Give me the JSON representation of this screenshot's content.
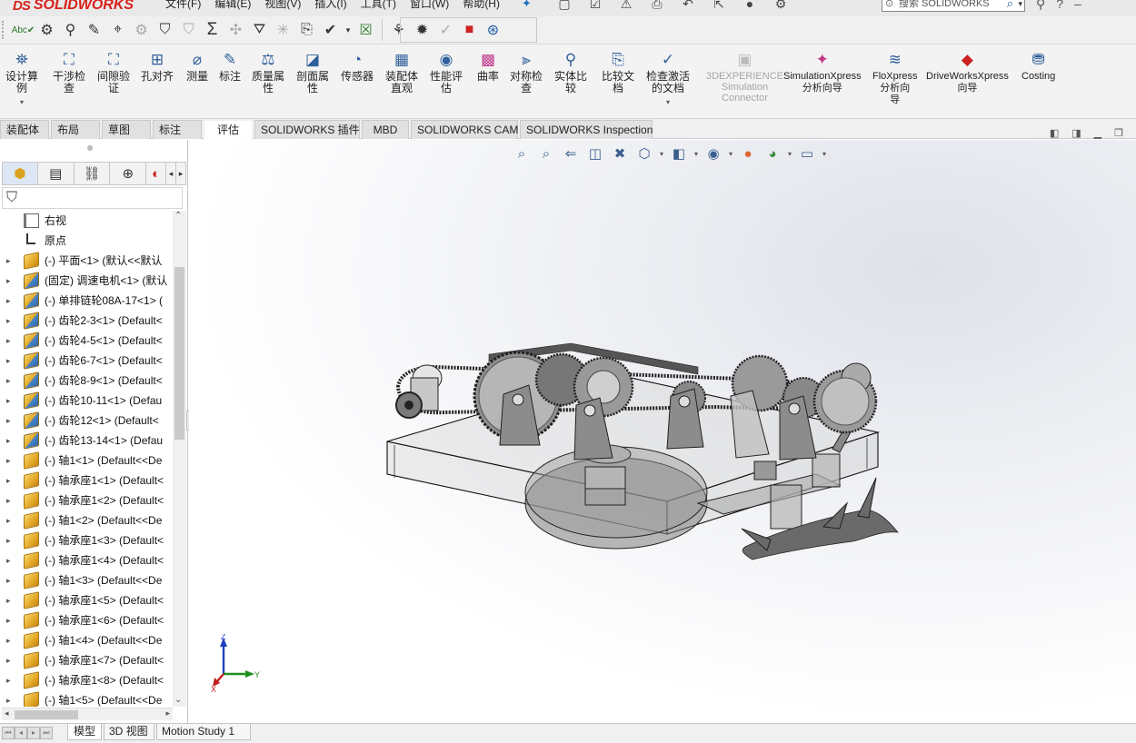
{
  "app": {
    "brand_ds": "DS",
    "brand_word": "SOLIDWORKS"
  },
  "menu": {
    "items": [
      "文件(F)",
      "编辑(E)",
      "视图(V)",
      "插入(I)",
      "工具(T)",
      "窗口(W)",
      "帮助(H)"
    ]
  },
  "search": {
    "placeholder": "搜索 SOLIDWORKS"
  },
  "command_manager": {
    "items": [
      {
        "label": "设计算\n例",
        "icon": "design-study-icon"
      },
      {
        "label": "干涉检\n查",
        "icon": "interference-icon"
      },
      {
        "label": "间隙验\n证",
        "icon": "clearance-icon"
      },
      {
        "label": "孔对齐",
        "icon": "hole-alignment-icon"
      },
      {
        "label": "测量",
        "icon": "measure-icon"
      },
      {
        "label": "标注",
        "icon": "markup-icon"
      },
      {
        "label": "质量属\n性",
        "icon": "mass-properties-icon"
      },
      {
        "label": "剖面属\n性",
        "icon": "section-properties-icon"
      },
      {
        "label": "传感器",
        "icon": "sensor-icon"
      },
      {
        "label": "装配体\n直观",
        "icon": "assembly-visualization-icon"
      },
      {
        "label": "性能评\n估",
        "icon": "performance-icon"
      },
      {
        "label": "曲率",
        "icon": "curvature-icon"
      },
      {
        "label": "对称检\n查",
        "icon": "symmetry-icon"
      },
      {
        "label": "实体比\n较",
        "icon": "body-compare-icon"
      },
      {
        "label": "比较文\n档",
        "icon": "compare-docs-icon"
      },
      {
        "label": "检查激活\n的文档",
        "icon": "check-doc-icon"
      },
      {
        "label": "3DEXPERIENCE\nSimulation\nConnector",
        "icon": "3dx-icon"
      },
      {
        "label": "SimulationXpress\n分析向导",
        "icon": "simxpress-icon"
      },
      {
        "label": "FloXpress\n分析向\n导",
        "icon": "floxpress-icon"
      },
      {
        "label": "DriveWorksXpress\n向导",
        "icon": "driveworks-icon"
      },
      {
        "label": "Costing",
        "icon": "costing-icon"
      }
    ]
  },
  "tabs": [
    "装配体",
    "布局",
    "草图",
    "标注",
    "评估",
    "SOLIDWORKS 插件",
    "MBD",
    "SOLIDWORKS CAM",
    "SOLIDWORKS Inspection"
  ],
  "active_tab": "评估",
  "feature_tree": {
    "items": [
      {
        "label": "右视",
        "kind": "plane",
        "expandable": false
      },
      {
        "label": "原点",
        "kind": "origin",
        "expandable": false
      },
      {
        "label": "(-) 平面<1> (默认<<默认",
        "kind": "part",
        "expandable": true
      },
      {
        "label": "(固定) 调速电机<1> (默认",
        "kind": "asm",
        "expandable": true
      },
      {
        "label": "(-) 单排链轮08A-17<1> (",
        "kind": "asm",
        "expandable": true
      },
      {
        "label": "(-) 齿轮2-3<1> (Default<",
        "kind": "asm",
        "expandable": true
      },
      {
        "label": "(-) 齿轮4-5<1> (Default<",
        "kind": "asm",
        "expandable": true
      },
      {
        "label": "(-) 齿轮6-7<1> (Default<",
        "kind": "asm",
        "expandable": true
      },
      {
        "label": "(-) 齿轮8-9<1> (Default<",
        "kind": "asm",
        "expandable": true
      },
      {
        "label": "(-) 齿轮10-11<1> (Defau",
        "kind": "asm",
        "expandable": true
      },
      {
        "label": "(-) 齿轮12<1> (Default<",
        "kind": "asm",
        "expandable": true
      },
      {
        "label": "(-) 齿轮13-14<1> (Defau",
        "kind": "asm",
        "expandable": true
      },
      {
        "label": "(-) 轴1<1> (Default<<De",
        "kind": "part",
        "expandable": true
      },
      {
        "label": "(-) 轴承座1<1> (Default<",
        "kind": "part",
        "expandable": true
      },
      {
        "label": "(-) 轴承座1<2> (Default<",
        "kind": "part",
        "expandable": true
      },
      {
        "label": "(-) 轴1<2> (Default<<De",
        "kind": "part",
        "expandable": true
      },
      {
        "label": "(-) 轴承座1<3> (Default<",
        "kind": "part",
        "expandable": true
      },
      {
        "label": "(-) 轴承座1<4> (Default<",
        "kind": "part",
        "expandable": true
      },
      {
        "label": "(-) 轴1<3> (Default<<De",
        "kind": "part",
        "expandable": true
      },
      {
        "label": "(-) 轴承座1<5> (Default<",
        "kind": "part",
        "expandable": true
      },
      {
        "label": "(-) 轴承座1<6> (Default<",
        "kind": "part",
        "expandable": true
      },
      {
        "label": "(-) 轴1<4> (Default<<De",
        "kind": "part",
        "expandable": true
      },
      {
        "label": "(-) 轴承座1<7> (Default<",
        "kind": "part",
        "expandable": true
      },
      {
        "label": "(-) 轴承座1<8> (Default<",
        "kind": "part",
        "expandable": true
      },
      {
        "label": "(-) 轴1<5> (Default<<De",
        "kind": "part",
        "expandable": true
      }
    ]
  },
  "bottom_tabs": [
    "模型",
    "3D 视图",
    "Motion Study 1"
  ],
  "active_bottom_tab": "模型",
  "triad": {
    "x": "X",
    "y": "Y",
    "z": "Z"
  }
}
